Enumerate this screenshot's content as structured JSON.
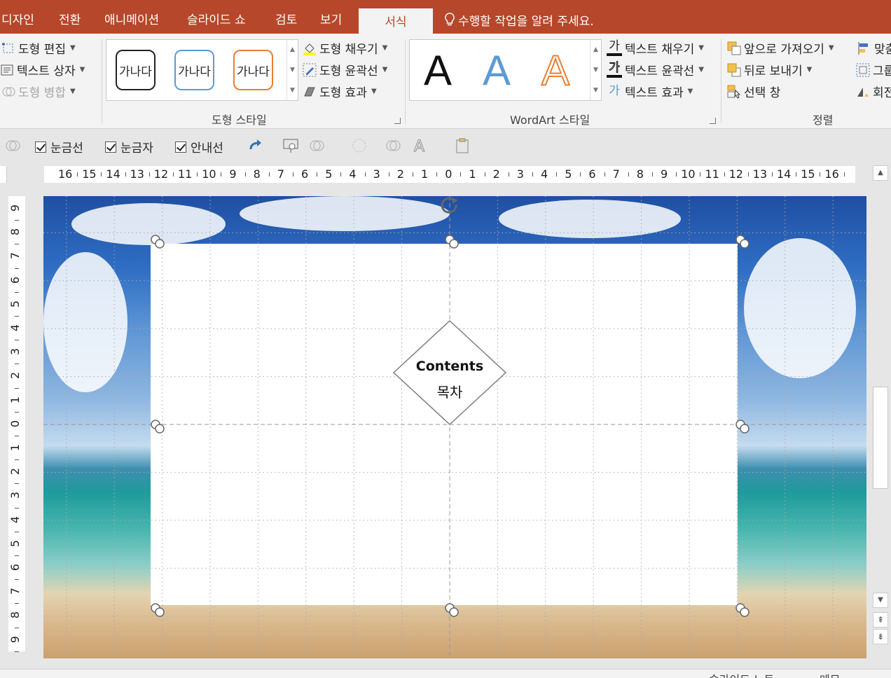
{
  "tabs": [
    {
      "label": "디자인"
    },
    {
      "label": "전환"
    },
    {
      "label": "애니메이션"
    },
    {
      "label": "슬라이드 쇼"
    },
    {
      "label": "검토"
    },
    {
      "label": "보기"
    },
    {
      "label": "서식",
      "active": true
    }
  ],
  "tell_me": "수행할 작업을 알려 주세요.",
  "ribbon": {
    "insert_shapes": {
      "edit_shape": "도형 편집",
      "text_box": "텍스트 상자",
      "merge_shapes": "도형 병합"
    },
    "shape_styles": {
      "label": "도형 스타일",
      "swatch_text": "가나다",
      "swatches": [
        {
          "border_color": "#222222"
        },
        {
          "border_color": "#5b9bd5"
        },
        {
          "border_color": "#ed7d31"
        }
      ],
      "fill": "도형 채우기",
      "outline": "도형 윤곽선",
      "effects": "도형 효과"
    },
    "wordart_styles": {
      "label": "WordArt 스타일",
      "letter": "A",
      "styles": [
        {
          "color": "#111111"
        },
        {
          "color": "#5b9bd5"
        },
        {
          "color": "#ed7d31"
        }
      ],
      "text_fill": "텍스트 채우기",
      "text_outline": "텍스트 윤곽선",
      "text_effects": "텍스트 효과",
      "icon_glyph": "가"
    },
    "arrange": {
      "label": "정렬",
      "bring_forward": "앞으로 가져오기",
      "send_backward": "뒤로 보내기",
      "selection_pane": "선택 창",
      "align": "맞춤",
      "group": "그룹",
      "rotate": "회전"
    }
  },
  "quick_toolbar": {
    "gridlines": {
      "label": "눈금선",
      "checked": true
    },
    "ruler": {
      "label": "눈금자",
      "checked": true
    },
    "guides": {
      "label": "안내선",
      "checked": true
    }
  },
  "ruler": {
    "horizontal_labels": [
      "16",
      "15",
      "14",
      "13",
      "12",
      "11",
      "10",
      "9",
      "8",
      "7",
      "6",
      "5",
      "4",
      "3",
      "2",
      "1",
      "0",
      "1",
      "2",
      "3",
      "4",
      "5",
      "6",
      "7",
      "8",
      "9",
      "10",
      "11",
      "12",
      "13",
      "14",
      "15",
      "16"
    ],
    "vertical_labels": [
      "9",
      "8",
      "7",
      "6",
      "5",
      "4",
      "3",
      "2",
      "1",
      "0",
      "1",
      "2",
      "3",
      "4",
      "5",
      "6",
      "7",
      "8",
      "9"
    ]
  },
  "slide": {
    "diamond_title": "Contents",
    "diamond_subtitle": "목차"
  },
  "statusbar": {
    "notes": "슬라이드 노트",
    "comments": "메모"
  },
  "colors": {
    "accent": "#b7472a",
    "ribbon_bg": "#f3f3f3"
  }
}
